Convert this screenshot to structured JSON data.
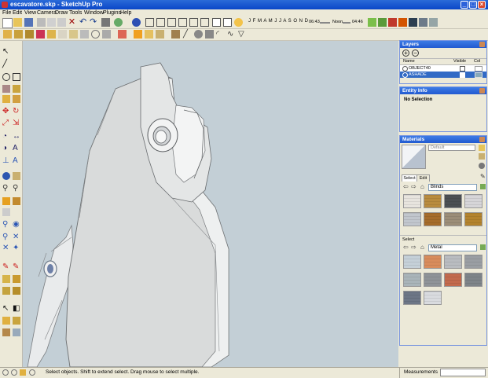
{
  "window": {
    "title": "escavatore.skp - SketchUp Pro"
  },
  "menu": [
    "File",
    "Edit",
    "View",
    "Camera",
    "Draw",
    "Tools",
    "Window",
    "Plugins",
    "Help"
  ],
  "shadow_bar": {
    "months": "J F M A M J J A S O N D",
    "time_start": "06:43",
    "time_noon": "Noon",
    "time_end": "04:46"
  },
  "layers": {
    "title": "Layers",
    "col_name": "Name",
    "col_visible": "Visible",
    "col_color": "Col",
    "rows": [
      {
        "name": "OBJECT40",
        "visible": false
      },
      {
        "name": "ASHADE",
        "visible": true
      }
    ]
  },
  "entity_info": {
    "title": "Entity Info",
    "text": "No Selection"
  },
  "materials": {
    "title": "Materials",
    "default_label": "Default",
    "tabs": [
      "Select",
      "Edit"
    ],
    "collection1": "Blinds",
    "select_label": "Select",
    "collection2": "Metal",
    "swatches1": [
      "#e7e4de",
      "#b88b3e",
      "#4b4f53",
      "#d6d5d8",
      "#c1c6cd",
      "#a56c2b",
      "#9b8d78",
      "#b3832e"
    ],
    "swatches2": [
      "#c5d0d8",
      "#d88c5c",
      "#b9bcc0",
      "#9a9ea3",
      "#a9b4b9",
      "#8f9398",
      "#c26a4d",
      "#7e8489",
      "#6d7686",
      "#d9dbdf"
    ]
  },
  "status": {
    "text": "Select objects. Shift to extend select. Drag mouse to select multiple.",
    "measurements_label": "Measurements"
  },
  "colors": {
    "viewport_bg": "#c3cfd6",
    "titlebar": "#0a46c8",
    "selected_row": "#316ac5"
  }
}
